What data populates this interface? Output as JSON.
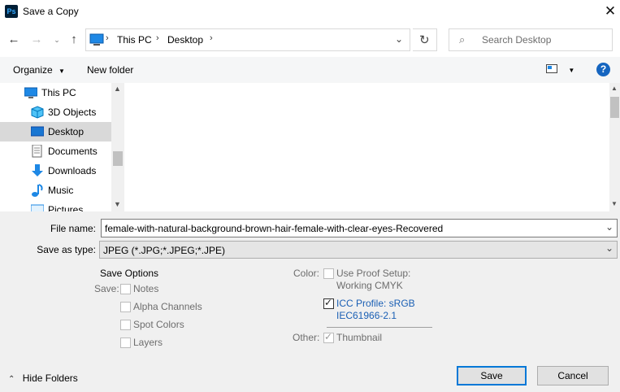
{
  "window": {
    "title": "Save a Copy",
    "app_icon_text": "Ps"
  },
  "nav": {
    "breadcrumb": [
      "This PC",
      "Desktop"
    ],
    "search_placeholder": "Search Desktop"
  },
  "toolbar": {
    "organize_label": "Organize",
    "new_folder_label": "New folder"
  },
  "sidebar": {
    "items": [
      {
        "label": "This PC",
        "icon": "computer-icon"
      },
      {
        "label": "3D Objects",
        "icon": "cube-icon"
      },
      {
        "label": "Desktop",
        "icon": "desktop-icon"
      },
      {
        "label": "Documents",
        "icon": "document-icon"
      },
      {
        "label": "Downloads",
        "icon": "download-icon"
      },
      {
        "label": "Music",
        "icon": "music-icon"
      },
      {
        "label": "Pictures",
        "icon": "pictures-icon"
      }
    ]
  },
  "form": {
    "file_name_label": "File name:",
    "file_name_value": "female-with-natural-background-brown-hair-female-with-clear-eyes-Recovered",
    "save_type_label": "Save as type:",
    "save_type_value": "JPEG (*.JPG;*.JPEG;*.JPE)"
  },
  "options": {
    "heading": "Save Options",
    "save_label": "Save:",
    "notes": "Notes",
    "alpha": "Alpha Channels",
    "spot": "Spot Colors",
    "layers": "Layers",
    "color_label": "Color:",
    "proof_line1": "Use Proof Setup:",
    "proof_line2": "Working CMYK",
    "icc_line1": "ICC Profile:  sRGB",
    "icc_line2": "IEC61966-2.1",
    "other_label": "Other:",
    "thumbnail": "Thumbnail"
  },
  "footer": {
    "hide_folders": "Hide Folders",
    "save": "Save",
    "cancel": "Cancel"
  },
  "colors": {
    "accent": "#0078d7",
    "help": "#1565c0",
    "icc_text": "#1a5fb4"
  }
}
